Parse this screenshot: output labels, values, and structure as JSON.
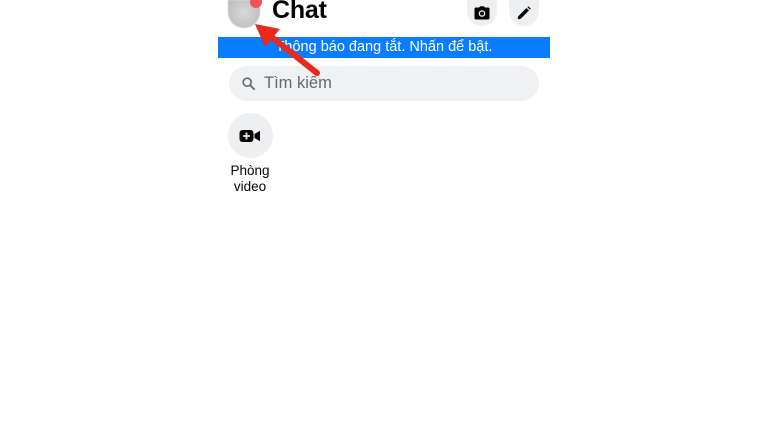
{
  "header": {
    "title": "Chat",
    "camera_icon": "camera-icon",
    "compose_icon": "pencil-icon"
  },
  "banner": {
    "text": "Thông báo đang tắt. Nhấn để bật."
  },
  "search": {
    "placeholder": "Tìm kiếm",
    "icon": "search-icon"
  },
  "rooms": [
    {
      "label": "Phòng\nvideo",
      "icon": "video-add-icon"
    }
  ],
  "colors": {
    "banner_background": "#0a7cff",
    "annotation_arrow": "#e8291c",
    "button_background": "#eeeff1",
    "search_background": "#f0f1f3"
  }
}
